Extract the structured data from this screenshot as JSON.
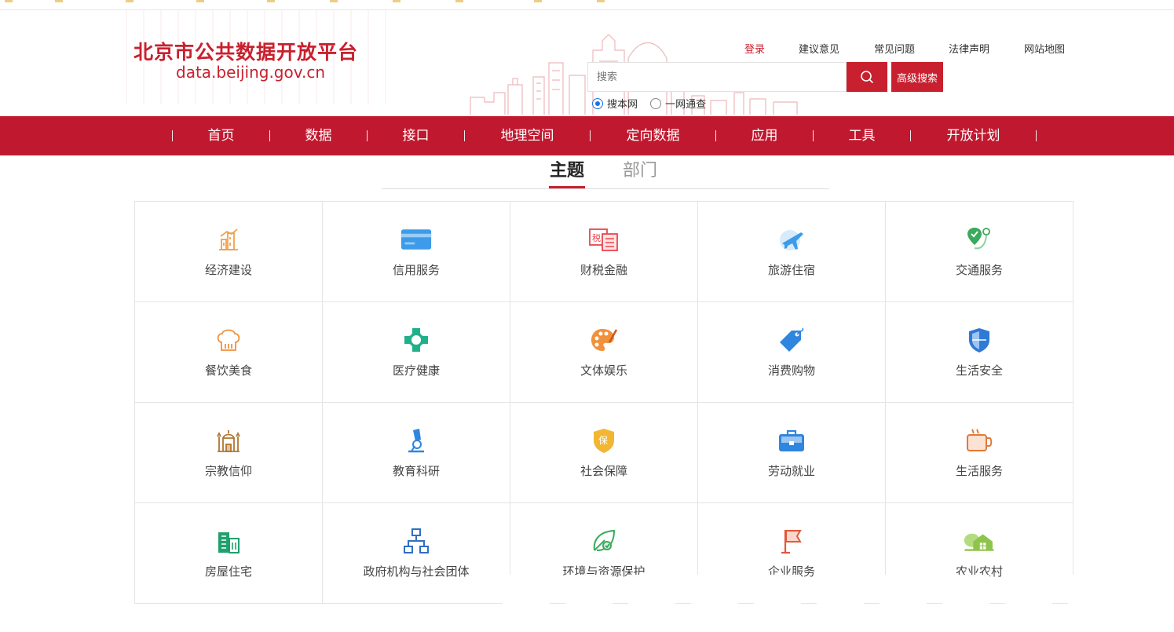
{
  "site": {
    "title": "北京市公共数据开放平台",
    "url": "data.beijing.gov.cn"
  },
  "toplinks": {
    "login": "登录",
    "feedback": "建议意见",
    "faq": "常见问题",
    "legal": "法律声明",
    "sitemap": "网站地图"
  },
  "search": {
    "placeholder": "搜索",
    "advanced_label": "高级搜索",
    "scope_options": [
      {
        "label": "搜本网",
        "selected": true
      },
      {
        "label": "一网通查",
        "selected": false
      }
    ]
  },
  "nav": {
    "items": [
      "首页",
      "数据",
      "接口",
      "地理空间",
      "定向数据",
      "应用",
      "工具",
      "开放计划"
    ]
  },
  "tabs": {
    "active": "主题",
    "inactive": "部门"
  },
  "topics": [
    {
      "label": "经济建设",
      "icon": "building-chart-icon",
      "color": "#f0a04b"
    },
    {
      "label": "信用服务",
      "icon": "credit-card-icon",
      "color": "#3d9be9"
    },
    {
      "label": "财税金融",
      "icon": "tax-document-icon",
      "color": "#e8474f"
    },
    {
      "label": "旅游住宿",
      "icon": "airplane-icon",
      "color": "#3d9be9"
    },
    {
      "label": "交通服务",
      "icon": "location-route-icon",
      "color": "#3aaa5c"
    },
    {
      "label": "餐饮美食",
      "icon": "chef-hat-icon",
      "color": "#f0913b"
    },
    {
      "label": "医疗健康",
      "icon": "medical-cross-icon",
      "color": "#21b08a"
    },
    {
      "label": "文体娱乐",
      "icon": "palette-icon",
      "color": "#f0913b"
    },
    {
      "label": "消费购物",
      "icon": "price-tag-icon",
      "color": "#2f86de"
    },
    {
      "label": "生活安全",
      "icon": "shield-icon",
      "color": "#2f7ad6"
    },
    {
      "label": "宗教信仰",
      "icon": "temple-icon",
      "color": "#b0752f"
    },
    {
      "label": "教育科研",
      "icon": "microscope-icon",
      "color": "#2f86de"
    },
    {
      "label": "社会保障",
      "icon": "insurance-badge-icon",
      "color": "#f2b632"
    },
    {
      "label": "劳动就业",
      "icon": "briefcase-icon",
      "color": "#2f86de"
    },
    {
      "label": "生活服务",
      "icon": "coffee-cup-icon",
      "color": "#e2783a"
    },
    {
      "label": "房屋住宅",
      "icon": "apartment-icon",
      "color": "#21a06f"
    },
    {
      "label": "政府机构与社会团体",
      "icon": "org-chart-icon",
      "color": "#2f6fc4"
    },
    {
      "label": "环境与资源保护",
      "icon": "leaf-icon",
      "color": "#3aaa5c"
    },
    {
      "label": "企业服务",
      "icon": "flag-icon",
      "color": "#e2583a"
    },
    {
      "label": "农业农村",
      "icon": "farmhouse-icon",
      "color": "#8dc44a"
    }
  ]
}
